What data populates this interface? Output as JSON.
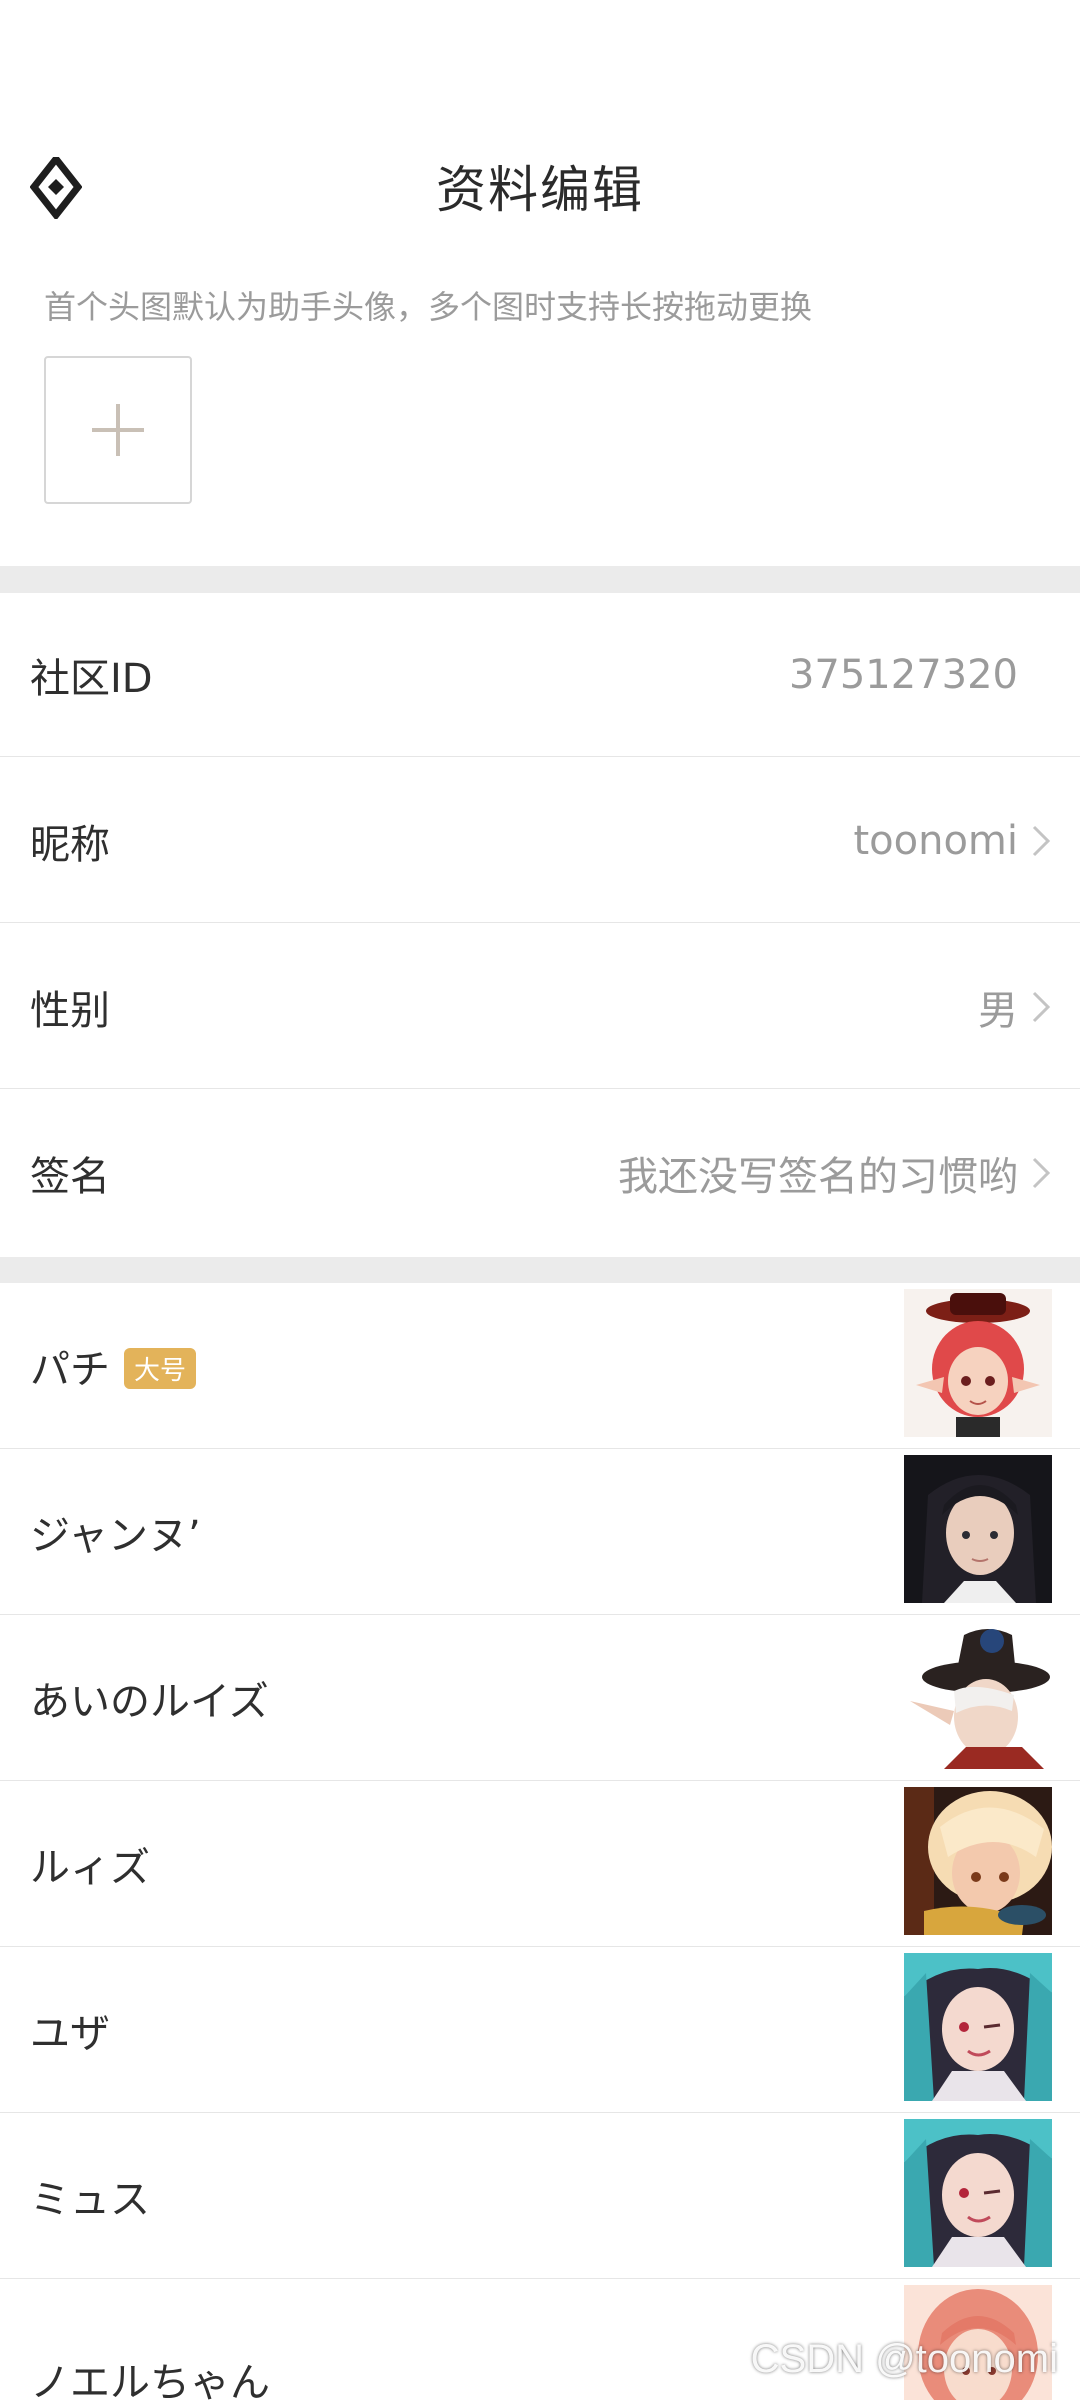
{
  "header": {
    "title": "资料编辑",
    "avatar_hint": "首个头图默认为助手头像，多个图时支持长按拖动更换",
    "add_symbol": "+"
  },
  "profile": {
    "rows": [
      {
        "label": "社区ID",
        "value": "375127320",
        "chevron": false
      },
      {
        "label": "昵称",
        "value": "toonomi",
        "chevron": true
      },
      {
        "label": "性别",
        "value": "男",
        "chevron": true
      },
      {
        "label": "签名",
        "value": "我还没写签名的习惯哟",
        "chevron": true
      }
    ]
  },
  "characters": [
    {
      "name": "パチ",
      "badge": "大号"
    },
    {
      "name": "ジャンヌ’",
      "badge": ""
    },
    {
      "name": "あいのルイズ",
      "badge": ""
    },
    {
      "name": "ルィズ",
      "badge": ""
    },
    {
      "name": "ユザ",
      "badge": ""
    },
    {
      "name": "ミュス",
      "badge": ""
    },
    {
      "name": "ノエルちゃん",
      "badge": ""
    }
  ],
  "watermark": "CSDN @toonomi",
  "colors": {
    "badge": "#e3b35a",
    "divider": "#ebebeb",
    "value_text": "#9b9b9b"
  }
}
